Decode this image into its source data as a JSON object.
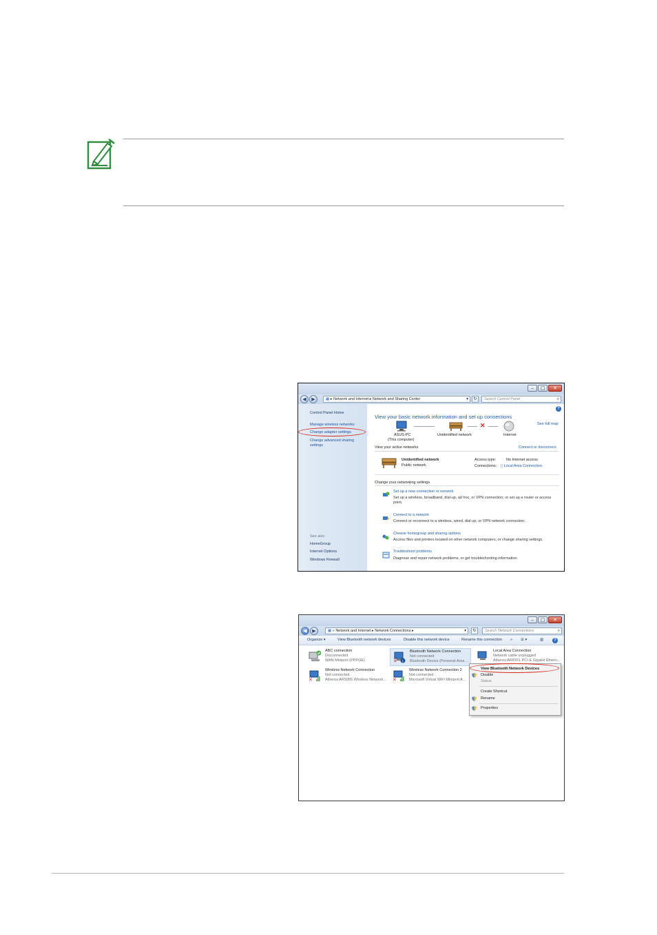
{
  "window1": {
    "address": {
      "segment1": "Network and Internet",
      "segment2": "Network and Sharing Center",
      "search_placeholder": "Search Control Panel"
    },
    "left_pane": {
      "home": "Control Panel Home",
      "links": [
        "Manage wireless networks",
        "Change adapter settings",
        "Change advanced sharing",
        "settings"
      ],
      "see_also": "See also",
      "see_also_links": [
        "HomeGroup",
        "Internet Options",
        "Windows Firewall"
      ]
    },
    "main": {
      "title": "View your basic network information and set up connections",
      "see_full_map": "See full map",
      "map": {
        "computer_name": "ASUS-PC",
        "computer_sub": "(This computer)",
        "network": "Unidentified network",
        "internet": "Internet"
      },
      "active_networks_label": "View your active networks",
      "connect_disconnect": "Connect or disconnect",
      "network_name": "Unidentified network",
      "network_type": "Public network",
      "access_type_label": "Access type:",
      "access_type_value": "No Internet access",
      "connections_label": "Connections:",
      "connections_value": "Local Area Connection",
      "settings_label": "Change your networking settings",
      "tasks": [
        {
          "title": "Set up a new connection or network",
          "desc1": "Set up a wireless, broadband, dial-up, ad hoc, or VPN connection; or set up a router or access",
          "desc2": "point."
        },
        {
          "title": "Connect to a network",
          "desc1": "Connect or reconnect to a wireless, wired, dial-up, or VPN network connection.",
          "desc2": ""
        },
        {
          "title": "Choose homegroup and sharing options",
          "desc1": "Access files and printers located on other network computers, or change sharing settings.",
          "desc2": ""
        },
        {
          "title": "Troubleshoot problems",
          "desc1": "Diagnose and repair network problems, or get troubleshooting information.",
          "desc2": ""
        }
      ]
    }
  },
  "window2": {
    "address": {
      "segment1": "Network and Internet",
      "segment2": "Network Connections",
      "search_placeholder": "Search Network Connections"
    },
    "toolbar": {
      "organize": "Organize",
      "view_bt": "View Bluetooth network devices",
      "disable": "Disable this network device",
      "rename": "Rename this connection",
      "more": "»"
    },
    "connections": [
      {
        "name": "ABC connection",
        "status": "Disconnected",
        "device": "WAN Miniport (PPPOE)"
      },
      {
        "name": "Bluetooth Network Connection",
        "status": "Not connected",
        "device": "Bluetooth Device (Personal Area ..."
      },
      {
        "name": "Local Area Connection",
        "status": "Network cable unplugged",
        "device": "Atheros AR8151 PCI-E Gigabit Ethern..."
      },
      {
        "name": "Wireless Network Connection",
        "status": "Not connected",
        "device": "Atheros AR9285 Wireless Network..."
      },
      {
        "name": "Wireless Network Connection 2",
        "status": "Not connected",
        "device": "Microsoft Virtual WiFi Miniport A..."
      }
    ],
    "context_menu": [
      "View Bluetooth Network Devices",
      "Disable",
      "Status",
      "Create Shortcut",
      "Rename",
      "Properties"
    ]
  },
  "colors": {
    "accent_link": "#1c5ab0",
    "highlight_ring": "#d6291f",
    "note_icon": "#2e8b3e"
  }
}
